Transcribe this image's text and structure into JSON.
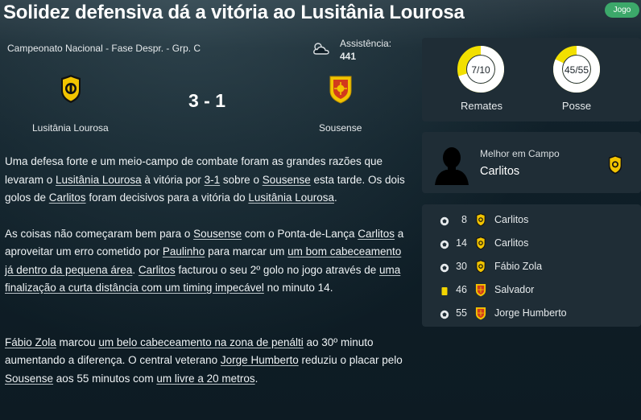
{
  "header": {
    "title": "Solidez defensiva dá a vitória ao Lusitânia Lourosa",
    "tag": "Jogo"
  },
  "match": {
    "competition": "Campeonato Nacional - Fase Despr. - Grp. C",
    "weather_icon": "cloudy-weather-icon",
    "attendance_label": "Assistência:",
    "attendance_value": "441",
    "score": "3 - 1",
    "home_team": "Lusitânia Lourosa",
    "away_team": "Sousense",
    "home_colors": {
      "primary": "#f2c400",
      "secondary": "#111111"
    },
    "away_colors": {
      "primary": "#f2c400",
      "secondary": "#d23a1c"
    }
  },
  "article": {
    "paragraphs": [
      [
        {
          "t": "Uma defesa forte e um meio-campo de combate foram as grandes razões que levaram o "
        },
        {
          "t": "Lusitânia Lourosa",
          "u": true
        },
        {
          "t": " à vitória por "
        },
        {
          "t": "3-1",
          "u": true
        },
        {
          "t": " sobre o "
        },
        {
          "t": "Sousense",
          "u": true
        },
        {
          "t": " esta tarde. Os dois golos de "
        },
        {
          "t": "Carlitos",
          "u": true
        },
        {
          "t": " foram decisivos para a vitória do "
        },
        {
          "t": "Lusitânia Lourosa",
          "u": true
        },
        {
          "t": "."
        }
      ],
      [
        {
          "t": "As coisas não começaram bem para o "
        },
        {
          "t": "Sousense",
          "u": true
        },
        {
          "t": " com o Ponta-de-Lança "
        },
        {
          "t": "Carlitos",
          "u": true
        },
        {
          "t": " a aproveitar um erro cometido por "
        },
        {
          "t": "Paulinho",
          "u": true
        },
        {
          "t": " para marcar um "
        },
        {
          "t": "um bom cabeceamento já dentro da pequena área",
          "u": true
        },
        {
          "t": ". "
        },
        {
          "t": "Carlitos",
          "u": true
        },
        {
          "t": " facturou o seu 2º golo no jogo através de "
        },
        {
          "t": "uma finalização a curta distância com um timing impecável",
          "u": true
        },
        {
          "t": " no minuto 14."
        }
      ],
      [
        {
          "t": "Fábio Zola",
          "u": true
        },
        {
          "t": " marcou "
        },
        {
          "t": "um belo cabeceamento na zona de penálti",
          "u": true
        },
        {
          "t": " ao 30º minuto aumentando a diferença. O central veterano "
        },
        {
          "t": "Jorge Humberto",
          "u": true
        },
        {
          "t": " reduziu o placar pelo "
        },
        {
          "t": "Sousense",
          "u": true
        },
        {
          "t": " aos 55 minutos com "
        },
        {
          "t": "um livre a 20 metros",
          "u": true
        },
        {
          "t": "."
        }
      ]
    ]
  },
  "stats": {
    "shots": {
      "label": "Remates",
      "home": 7,
      "total": 10,
      "display": "7/10"
    },
    "possession": {
      "label": "Posse",
      "home": 45,
      "total": 55,
      "display": "45/55"
    },
    "ring_colors": {
      "home": "#ffffff",
      "away": "#f2e000"
    }
  },
  "motm": {
    "label": "Melhor em Campo",
    "name": "Carlitos"
  },
  "events": [
    {
      "type": "goal",
      "icon": "ball-icon",
      "minute": "8",
      "team": "home",
      "player": "Carlitos"
    },
    {
      "type": "goal",
      "icon": "ball-icon",
      "minute": "14",
      "team": "home",
      "player": "Carlitos"
    },
    {
      "type": "goal",
      "icon": "ball-icon",
      "minute": "30",
      "team": "home",
      "player": "Fábio Zola"
    },
    {
      "type": "yellow-card",
      "icon": "yellow-card-icon",
      "minute": "46",
      "team": "away",
      "player": "Salvador"
    },
    {
      "type": "goal",
      "icon": "ball-icon",
      "minute": "55",
      "team": "away",
      "player": "Jorge Humberto"
    }
  ]
}
